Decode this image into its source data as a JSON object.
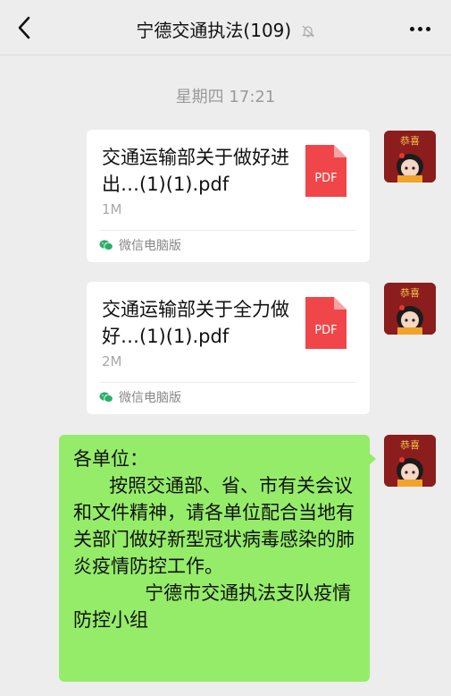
{
  "header": {
    "title": "宁德交通执法(109)",
    "back_icon": "chevron-left-icon",
    "mute_icon": "bell-off-icon",
    "more_icon": "more-dots-icon"
  },
  "chat": {
    "timestamp": "星期四 17:21",
    "messages": [
      {
        "type": "file",
        "file_name": "交通运输部关于做好进出…(1)(1).pdf",
        "file_size": "1M",
        "file_icon_label": "PDF",
        "source": "微信电脑版"
      },
      {
        "type": "file",
        "file_name": "交通运输部关于全力做好…(1)(1).pdf",
        "file_size": "2M",
        "file_icon_label": "PDF",
        "source": "微信电脑版"
      },
      {
        "type": "text",
        "text": "各单位：\n      按照交通部、省、市有关会议和文件精神，请各单位配合当地有关部门做好新型冠状病毒感染的肺炎疫情防控工作。\n            宁德市交通执法支队疫情防控小组"
      }
    ]
  },
  "avatar": {
    "label": "恭喜"
  },
  "colors": {
    "background": "#ededed",
    "sent_bubble": "#95ec69",
    "pdf_red": "#f0464a",
    "wechat_green": "#2aae67"
  }
}
